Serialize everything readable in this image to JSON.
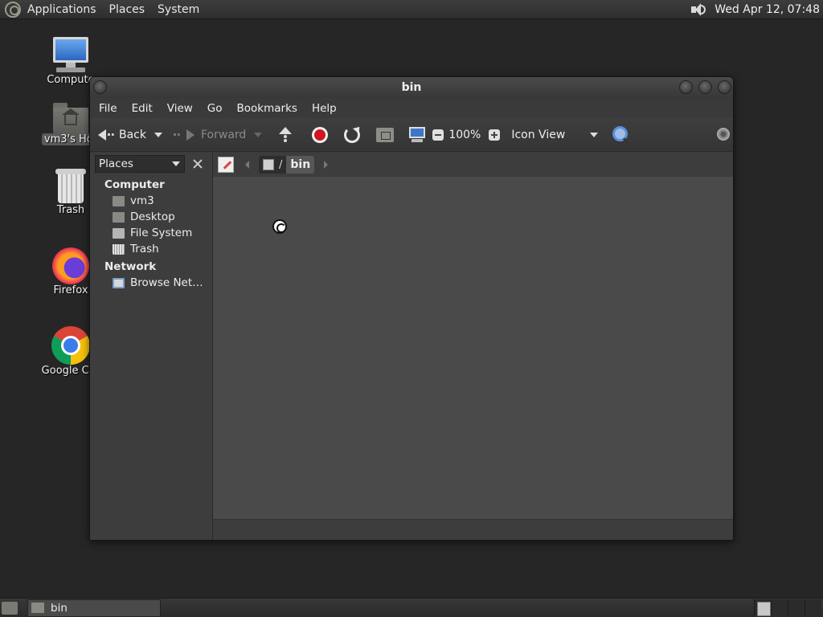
{
  "top_panel": {
    "menus": [
      "Applications",
      "Places",
      "System"
    ],
    "clock": "Wed Apr 12, 07:48"
  },
  "desktop": {
    "icons": [
      {
        "label": "Compute",
        "icon": "computer-icon"
      },
      {
        "label": "vm3's Hor",
        "icon": "home-folder-icon"
      },
      {
        "label": "Trash",
        "icon": "trash-icon"
      },
      {
        "label": "Firefox",
        "icon": "firefox-icon"
      },
      {
        "label": "Google Chr",
        "icon": "chrome-icon"
      }
    ]
  },
  "window": {
    "title": "bin",
    "menubar": [
      "File",
      "Edit",
      "View",
      "Go",
      "Bookmarks",
      "Help"
    ],
    "toolbar": {
      "back_label": "Back",
      "forward_label": "Forward",
      "zoom_level": "100%",
      "view_mode": "Icon View"
    },
    "sidebar": {
      "selector_label": "Places",
      "sections": [
        {
          "heading": "Computer",
          "items": [
            {
              "label": "vm3",
              "icon": "home-folder-icon"
            },
            {
              "label": "Desktop",
              "icon": "desktop-folder-icon"
            },
            {
              "label": "File System",
              "icon": "drive-icon"
            },
            {
              "label": "Trash",
              "icon": "trash-icon"
            }
          ]
        },
        {
          "heading": "Network",
          "items": [
            {
              "label": "Browse Net…",
              "icon": "network-icon"
            }
          ]
        }
      ]
    },
    "pathbar": {
      "separator": "/",
      "current": "bin"
    }
  },
  "taskbar": {
    "tasks": [
      {
        "label": "bin",
        "icon": "folder-icon"
      }
    ]
  }
}
